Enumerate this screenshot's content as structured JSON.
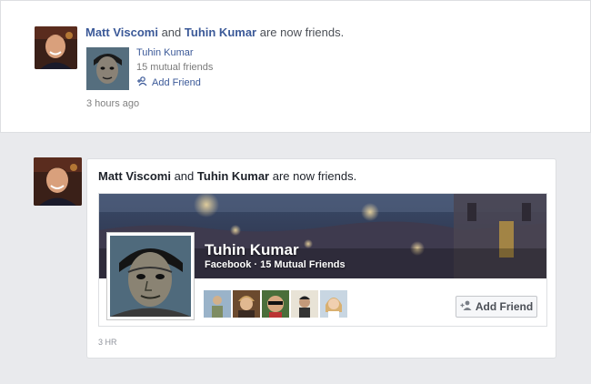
{
  "story_compact": {
    "actor_name": "Matt Viscomi",
    "connector": "and",
    "friend_name": "Tuhin Kumar",
    "suffix": "are now friends.",
    "attachment": {
      "name": "Tuhin Kumar",
      "mutual_friends": "15 mutual friends",
      "add_friend_label": "Add Friend"
    },
    "timestamp": "3 hours ago"
  },
  "story_card": {
    "actor_name": "Matt Viscomi",
    "connector": "and",
    "friend_name": "Tuhin Kumar",
    "suffix": "are now friends.",
    "profile": {
      "name": "Tuhin Kumar",
      "subtitle": "Facebook · 15 Mutual Friends",
      "add_friend_label": "Add Friend",
      "mutual_friend_photos": [
        "mutual-friend-1",
        "mutual-friend-2",
        "mutual-friend-3",
        "mutual-friend-4",
        "mutual-friend-5"
      ]
    },
    "timestamp": "3 HR"
  },
  "colors": {
    "link_blue": "#3b5998",
    "background": "#e9eaed",
    "card": "#ffffff"
  }
}
